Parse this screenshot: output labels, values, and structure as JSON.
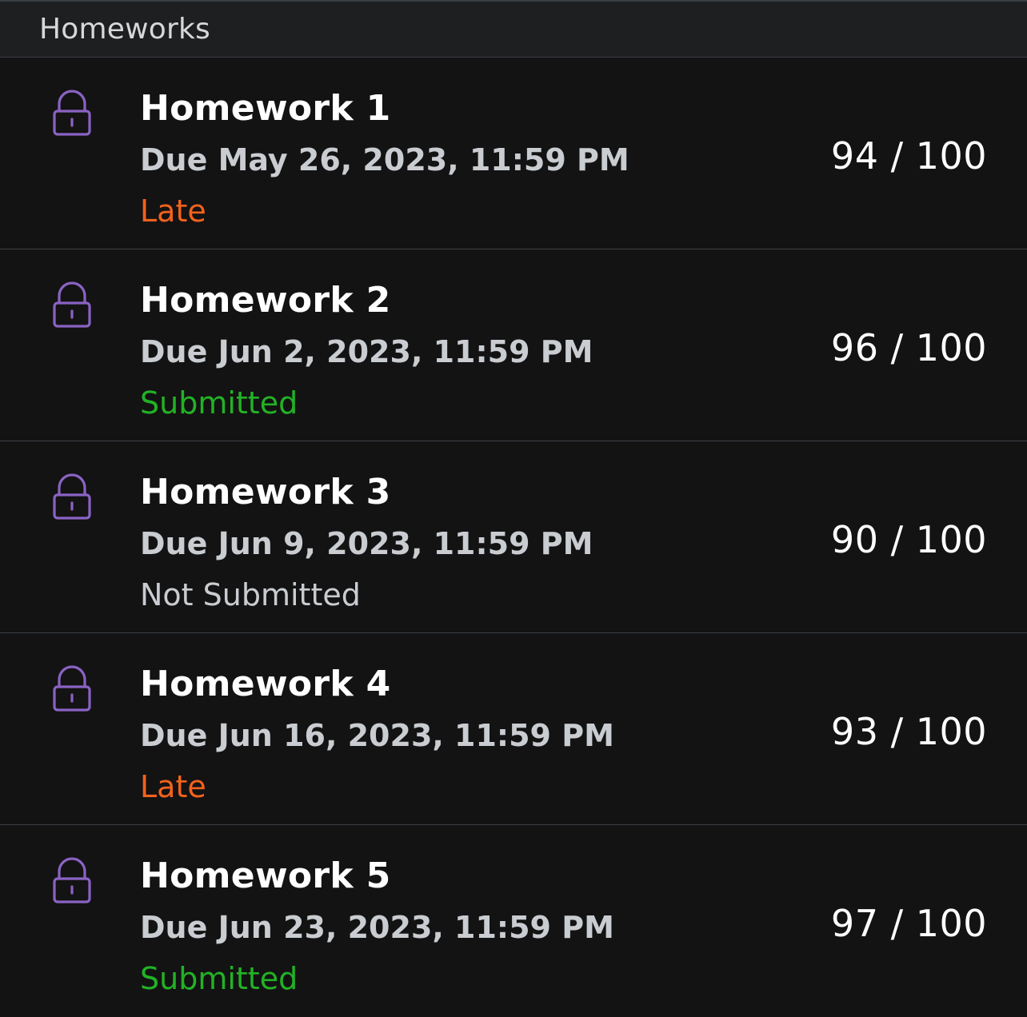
{
  "section": {
    "title": "Homeworks"
  },
  "colors": {
    "lock": "#8a63c4",
    "late": "#f3621d",
    "submitted": "#22b225",
    "not_submitted": "#c9ccd0"
  },
  "homeworks": [
    {
      "icon": "lock-icon",
      "title": "Homework  1",
      "due": "Due May 26, 2023, 11:59 PM",
      "status": "Late",
      "status_kind": "late",
      "score": "94 / 100"
    },
    {
      "icon": "lock-icon",
      "title": "Homework 2",
      "due": "Due Jun 2, 2023, 11:59 PM",
      "status": "Submitted",
      "status_kind": "submitted",
      "score": "96 / 100"
    },
    {
      "icon": "lock-icon",
      "title": "Homework 3",
      "due": "Due Jun 9, 2023, 11:59 PM",
      "status": "Not Submitted",
      "status_kind": "not-submitted",
      "score": "90 / 100"
    },
    {
      "icon": "lock-icon",
      "title": "Homework 4",
      "due": "Due Jun 16, 2023, 11:59 PM",
      "status": "Late",
      "status_kind": "late",
      "score": "93 / 100"
    },
    {
      "icon": "lock-icon",
      "title": "Homework 5",
      "due": "Due Jun 23, 2023, 11:59 PM",
      "status": "Submitted",
      "status_kind": "submitted",
      "score": "97 / 100"
    }
  ]
}
